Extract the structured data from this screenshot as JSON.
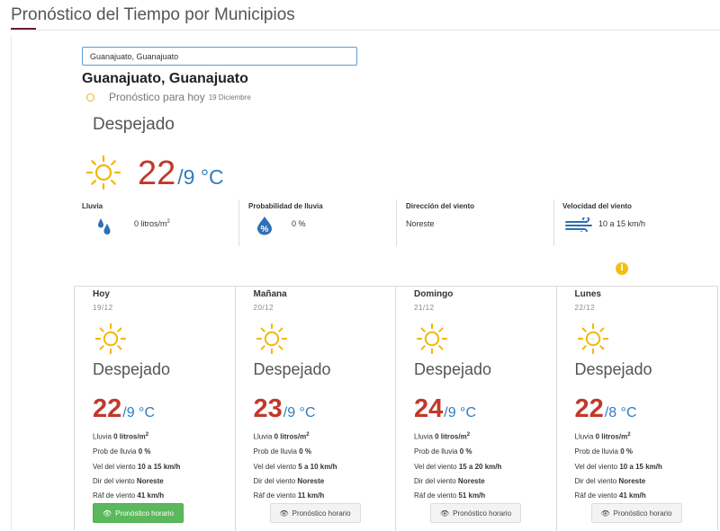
{
  "page_title": "Pronóstico del Tiempo por Municipios",
  "search": {
    "value": "Guanajuato, Guanajuato"
  },
  "location": "Guanajuato, Guanajuato",
  "today": {
    "label": "Pronóstico para hoy",
    "date": "19 Diciembre",
    "condition": "Despejado",
    "max": "22",
    "min": "/9 °C"
  },
  "stats": [
    {
      "label": "Lluvia",
      "value": "0 litros/m",
      "sup": "2",
      "icon": "rain-drops-icon"
    },
    {
      "label": "Probabilidad de lluvia",
      "value": "0 %",
      "icon": "percent-icon"
    },
    {
      "label": "Dirección del viento",
      "value": "Noreste"
    },
    {
      "label": "Velocidad del viento",
      "value": "10 a 15 km/h",
      "icon": "wind-icon"
    }
  ],
  "labels": {
    "rain": "Lluvia ",
    "prob": "Prob de lluvia ",
    "wind": "Vel del viento ",
    "dir": "Dir del viento ",
    "gust": "Ráf de viento ",
    "button": "Pronóstico horario"
  },
  "days": [
    {
      "day": "Hoy",
      "date": "19/12",
      "condition": "Despejado",
      "max": "22",
      "min": "/9 °C",
      "rain": "0 litros/m",
      "rain_sup": "2",
      "prob": "0 %",
      "wind": "10 a 15 km/h",
      "dir": "Noreste",
      "gust": "41 km/h"
    },
    {
      "day": "Mañana",
      "date": "20/12",
      "condition": "Despejado",
      "max": "23",
      "min": "/9 °C",
      "rain": "0 litros/m",
      "rain_sup": "2",
      "prob": "0 %",
      "wind": "5 a 10 km/h",
      "dir": "Noreste",
      "gust": "11 km/h"
    },
    {
      "day": "Domingo",
      "date": "21/12",
      "condition": "Despejado",
      "max": "24",
      "min": "/9 °C",
      "rain": "0 litros/m",
      "rain_sup": "2",
      "prob": "0 %",
      "wind": "15 a 20 km/h",
      "dir": "Noreste",
      "gust": "51 km/h"
    },
    {
      "day": "Lunes",
      "date": "22/12",
      "condition": "Despejado",
      "max": "22",
      "min": "/8 °C",
      "rain": "0 litros/m",
      "rain_sup": "2",
      "prob": "0 %",
      "wind": "10 a 15 km/h",
      "dir": "Noreste",
      "gust": "41 km/h"
    }
  ],
  "colors": {
    "max_temp": "#c0392b",
    "min_temp": "#2f7cc0",
    "sun": "#f2b705",
    "accent": "#6b1e2e",
    "button_active": "#5cb85c"
  }
}
